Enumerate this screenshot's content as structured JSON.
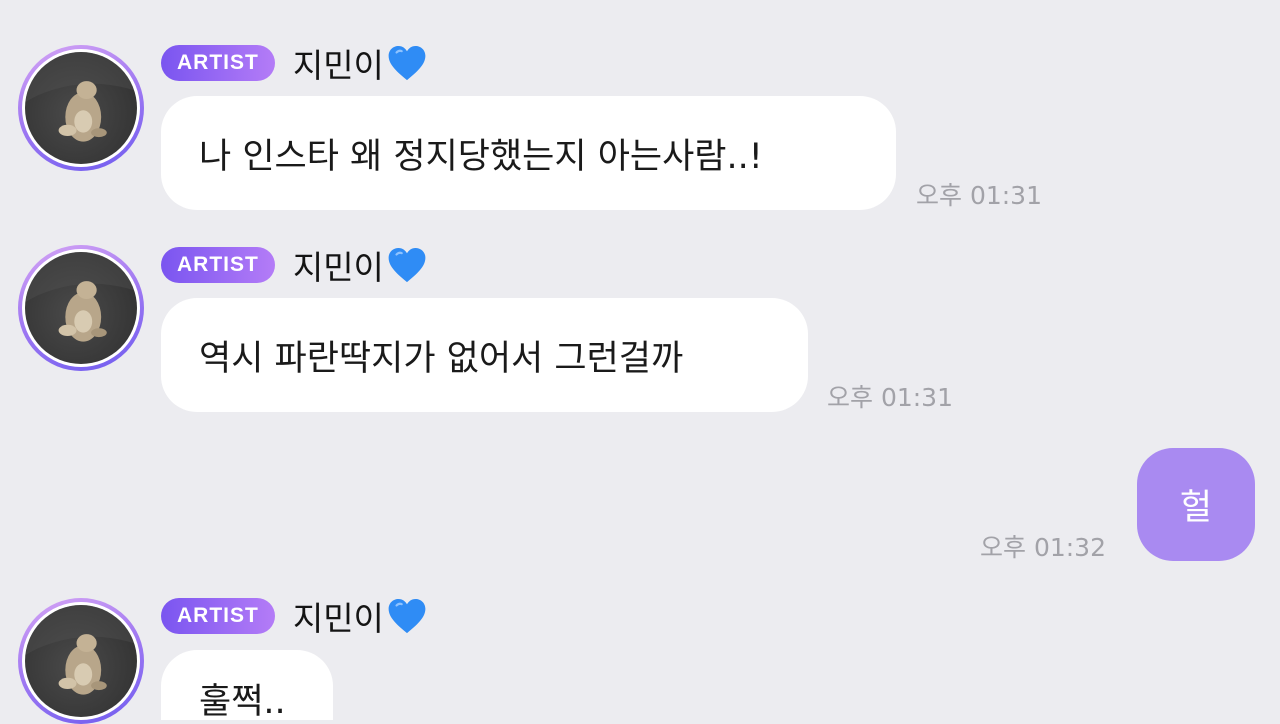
{
  "messages": [
    {
      "badge": "ARTIST",
      "sender": "지민이",
      "heart_icon": "blue-heart-icon",
      "text": "나 인스타 왜 정지당했는지 아는사람..!",
      "time": "오후 01:31"
    },
    {
      "badge": "ARTIST",
      "sender": "지민이",
      "heart_icon": "blue-heart-icon",
      "text": "역시 파란딱지가 없어서 그런걸까",
      "time": "오후 01:31"
    },
    {
      "text": "헐",
      "time": "오후 01:32"
    },
    {
      "badge": "ARTIST",
      "sender": "지민이",
      "heart_icon": "blue-heart-icon",
      "text": "훌쩍.."
    }
  ],
  "colors": {
    "background": "#ececf0",
    "artist_badge_start": "#7a55f0",
    "artist_badge_end": "#b47cf7",
    "my_bubble": "#a98af1",
    "time_text": "#a2a2a8",
    "heart": "#2f8cf5"
  }
}
